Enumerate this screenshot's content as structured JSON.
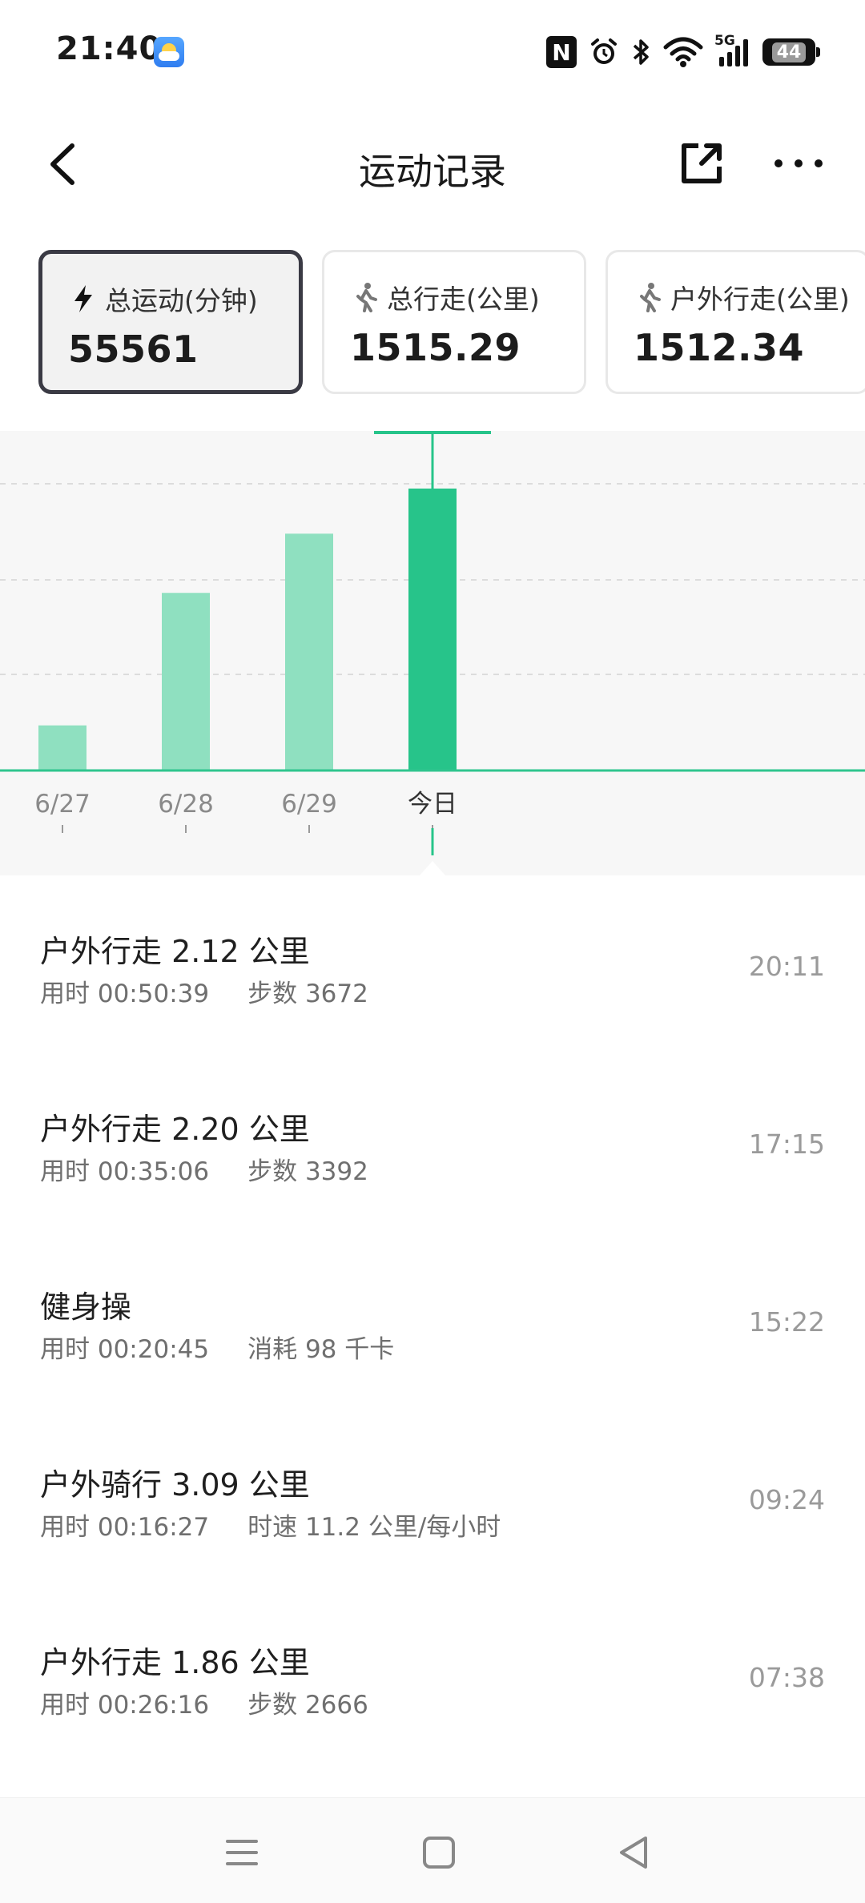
{
  "status_bar": {
    "time": "21:40",
    "battery": "44",
    "network": "5G",
    "icons": [
      "weather-icon",
      "nfc-icon",
      "alarm-icon",
      "bluetooth-icon",
      "wifi-icon",
      "signal-icon",
      "battery-icon"
    ]
  },
  "header": {
    "title": "运动记录",
    "icons": [
      "back-arrow-icon",
      "share-icon",
      "more-icon"
    ]
  },
  "cards": [
    {
      "label": "总运动(分钟)",
      "value": "55561",
      "icon": "lightning-icon",
      "active": true
    },
    {
      "label": "总行走(公里)",
      "value": "1515.29",
      "icon": "walk-icon",
      "active": false
    },
    {
      "label": "户外行走(公里)",
      "value": "1512.34",
      "icon": "walk-icon",
      "active": false
    }
  ],
  "chart_data": {
    "type": "bar",
    "categories": [
      "6/27",
      "6/28",
      "6/29",
      "今日"
    ],
    "values": [
      0.16,
      0.63,
      0.84,
      1.0
    ],
    "selected_index": 3,
    "grid": true,
    "colors": {
      "bar": "#8fe0c0",
      "selected": "#27c48a",
      "baseline": "#2fc58e"
    }
  },
  "records": [
    {
      "title": "户外行走 2.12 公里",
      "duration": "用时 00:50:39",
      "metric": "步数 3672",
      "time": "20:11"
    },
    {
      "title": "户外行走 2.20 公里",
      "duration": "用时 00:35:06",
      "metric": "步数 3392",
      "time": "17:15"
    },
    {
      "title": "健身操",
      "duration": "用时 00:20:45",
      "metric": "消耗 98 千卡",
      "time": "15:22"
    },
    {
      "title": "户外骑行 3.09 公里",
      "duration": "用时 00:16:27",
      "metric": "时速 11.2 公里/每小时",
      "time": "09:24"
    },
    {
      "title": "户外行走 1.86 公里",
      "duration": "用时 00:26:16",
      "metric": "步数 2666",
      "time": "07:38"
    }
  ],
  "nav": {
    "icons": [
      "menu-icon",
      "home-icon",
      "back-icon"
    ]
  }
}
